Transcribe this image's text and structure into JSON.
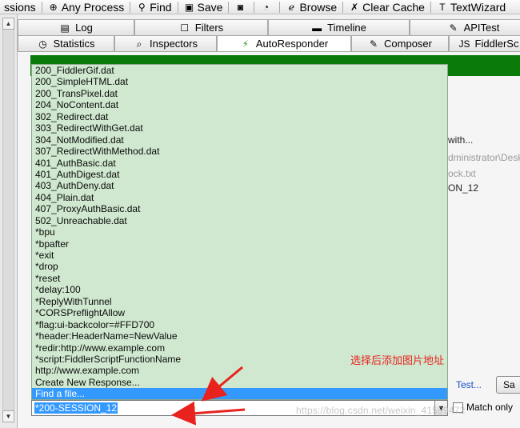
{
  "toolbar": {
    "items": [
      {
        "label": "ssions",
        "icon": "chevron-down-icon"
      },
      {
        "label": "Any Process",
        "icon": "crosshair-icon"
      },
      {
        "label": "Find",
        "icon": "binoculars-icon"
      },
      {
        "label": "Save",
        "icon": "save-icon"
      },
      {
        "label": "",
        "icon": "camera-icon"
      },
      {
        "label": "",
        "icon": "timer-icon"
      },
      {
        "label": "Browse",
        "icon": "browser-icon"
      },
      {
        "label": "Clear Cache",
        "icon": "clear-icon"
      },
      {
        "label": "TextWizard",
        "icon": "textwizard-icon"
      }
    ]
  },
  "tabs_top": [
    {
      "label": "Log",
      "icon": "log-icon"
    },
    {
      "label": "Filters",
      "icon": "filter-icon"
    },
    {
      "label": "Timeline",
      "icon": "timeline-icon"
    },
    {
      "label": "APITest",
      "icon": "apitest-icon"
    }
  ],
  "tabs_bottom": [
    {
      "label": "Statistics",
      "icon": "stopwatch-icon"
    },
    {
      "label": "Inspectors",
      "icon": "inspector-icon"
    },
    {
      "label": "AutoResponder",
      "icon": "lightning-icon"
    },
    {
      "label": "Composer",
      "icon": "composer-icon"
    },
    {
      "label": "FiddlerSc",
      "icon": "script-icon"
    }
  ],
  "background": {
    "with_label": "d with...",
    "path_label": "dministrator\\Desk",
    "file_label": "ock.txt",
    "session_label": "ON_12"
  },
  "dropdown": {
    "items": [
      "200_FiddlerGif.dat",
      "200_SimpleHTML.dat",
      "200_TransPixel.dat",
      "204_NoContent.dat",
      "302_Redirect.dat",
      "303_RedirectWithGet.dat",
      "304_NotModified.dat",
      "307_RedirectWithMethod.dat",
      "401_AuthBasic.dat",
      "401_AuthDigest.dat",
      "403_AuthDeny.dat",
      "404_Plain.dat",
      "407_ProxyAuthBasic.dat",
      "502_Unreachable.dat",
      "*bpu",
      "*bpafter",
      "*exit",
      "*drop",
      "*reset",
      "*delay:100",
      "*ReplyWithTunnel",
      "*CORSPreflightAllow",
      "*flag:ui-backcolor=#FFD700",
      "*header:HeaderName=NewValue",
      "*redir:http://www.example.com",
      "*script:FiddlerScriptFunctionName",
      "http://www.example.com",
      "Create New Response...",
      "Find a file..."
    ],
    "selected_index": 28
  },
  "combo": {
    "value": "*200-SESSION_12"
  },
  "annotation": "选择后添加图片地址",
  "test_label": "Test...",
  "save_label": "Sa",
  "match_only_label": "Match only",
  "watermark": "https://blog.csdn.net/weixin_41599472",
  "colors": {
    "banner": "#0a7a0a",
    "dropdown_bg": "#cfe8cf",
    "selection": "#3399ff",
    "annotation": "#e8231e"
  }
}
